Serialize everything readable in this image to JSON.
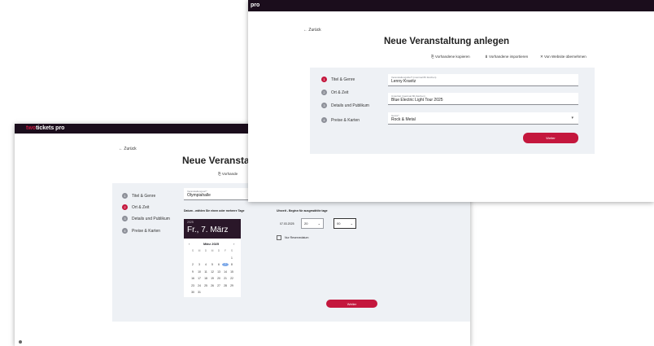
{
  "brand": {
    "prefix": "two",
    "suffix": "tickets pro",
    "partial": "pro",
    "accent": "#c4173d",
    "dark": "#1b0d1c"
  },
  "front": {
    "back_label": "← Zurück",
    "title": "Neue Veranstaltung anlegen",
    "actions": {
      "copy": "Vorhandene kopieren",
      "import": "Vorhandene importieren",
      "website": "Von Website übernehmen"
    },
    "steps": [
      {
        "num": "1",
        "label": "Titel & Genre"
      },
      {
        "num": "2",
        "label": "Ort & Zeit"
      },
      {
        "num": "3",
        "label": "Details und Publikum"
      },
      {
        "num": "4",
        "label": "Preise & Karten"
      }
    ],
    "fields": [
      {
        "label": "Veranstaltungstitel* (maximal 80 Zeichen)",
        "value": "Lenny Kravitz"
      },
      {
        "label": "Untertitel (maximal 80 Zeichen)",
        "value": "Blue Electric Light Tour 2025"
      },
      {
        "label": "Genre*",
        "value": "Rock & Metal"
      }
    ],
    "next_label": "Weiter"
  },
  "back": {
    "back_label": "← Zurück",
    "title": "Neue Veranstalt",
    "copy_partial": "Vorhande",
    "steps": [
      {
        "num": "1",
        "label": "Titel & Genre"
      },
      {
        "num": "2",
        "label": "Ort & Zeit"
      },
      {
        "num": "3",
        "label": "Details und Publikum"
      },
      {
        "num": "4",
        "label": "Preise & Karten"
      }
    ],
    "venue_label": "Veranstaltungsort*",
    "venue_value": "Olympiahalle",
    "date_prompt": "Datum - wählen Sie einen oder mehrere Tage",
    "time_prompt": "Uhrzeit - Beginn für ausgewählte tage",
    "calendar": {
      "year": "2025",
      "selected": "Fr., 7. März",
      "month": "März 2025",
      "weekdays": [
        "S",
        "M",
        "D",
        "M",
        "D",
        "F",
        "S"
      ],
      "weeks": [
        [
          "",
          "",
          "",
          "",
          "",
          "",
          "1"
        ],
        [
          "2",
          "3",
          "4",
          "5",
          "6",
          "7",
          "8"
        ],
        [
          "9",
          "10",
          "11",
          "12",
          "13",
          "14",
          "15"
        ],
        [
          "16",
          "17",
          "18",
          "19",
          "20",
          "21",
          "22"
        ],
        [
          "23",
          "24",
          "25",
          "26",
          "27",
          "28",
          "29"
        ],
        [
          "30",
          "31",
          "",
          "",
          "",
          "",
          ""
        ]
      ]
    },
    "time_row": {
      "date": "07.03.2025",
      "hour": "20",
      "minute": "00"
    },
    "reserve_label": "Nur Reservedatum",
    "next_label": "Weiter"
  }
}
